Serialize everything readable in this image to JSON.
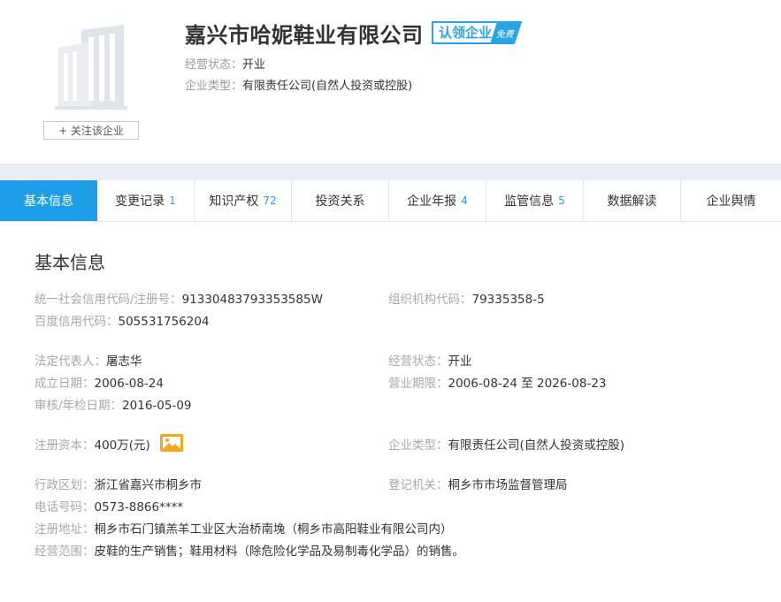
{
  "header": {
    "company_name": "嘉兴市哈妮鞋业有限公司",
    "claim_badge": "认领企业",
    "claim_badge_tag": "免费",
    "status_label": "经营状态：",
    "status_value": "开业",
    "type_label": "企业类型：",
    "type_value": "有限责任公司(自然人投资或控股)",
    "follow_button": "+ 关注该企业",
    "logo_icon": "building-icon"
  },
  "tabs": [
    {
      "label": "基本信息",
      "count": ""
    },
    {
      "label": "变更记录",
      "count": "1"
    },
    {
      "label": "知识产权",
      "count": "72"
    },
    {
      "label": "投资关系",
      "count": ""
    },
    {
      "label": "企业年报",
      "count": "4"
    },
    {
      "label": "监管信息",
      "count": "5"
    },
    {
      "label": "数据解读",
      "count": ""
    },
    {
      "label": "企业舆情",
      "count": ""
    }
  ],
  "basic_info": {
    "title": "基本信息",
    "credit_code_label": "统一社会信用代码/注册号：",
    "credit_code": "91330483793353585W",
    "org_code_label": "组织机构代码：",
    "org_code": "79335358-5",
    "baidu_code_label": "百度信用代码：",
    "baidu_code": "505531756204",
    "legal_rep_label": "法定代表人：",
    "legal_rep": "屠志华",
    "status_label": "经营状态：",
    "status": "开业",
    "founded_label": "成立日期：",
    "founded": "2006-08-24",
    "term_label": "营业期限：",
    "term": "2006-08-24 至 2026-08-23",
    "audit_label": "审核/年检日期：",
    "audit": "2016-05-09",
    "capital_label": "注册资本：",
    "capital": "400万(元)",
    "capital_icon": "image-icon",
    "type_label": "企业类型：",
    "type": "有限责任公司(自然人投资或控股)",
    "region_label": "行政区划：",
    "region": "浙江省嘉兴市桐乡市",
    "authority_label": "登记机关：",
    "authority": "桐乡市市场监督管理局",
    "phone_label": "电话号码：",
    "phone": "0573-8866****",
    "address_label": "注册地址：",
    "address": "桐乡市石门镇羔羊工业区大治桥南堍（桐乡市高阳鞋业有限公司内）",
    "scope_label": "经营范围：",
    "scope": "皮鞋的生产销售；鞋用材料（除危险化学品及易制毒化学品）的销售。"
  },
  "colors": {
    "accent": "#1d9ee6",
    "label": "#a7a7a7",
    "band": "#e9eef5"
  }
}
